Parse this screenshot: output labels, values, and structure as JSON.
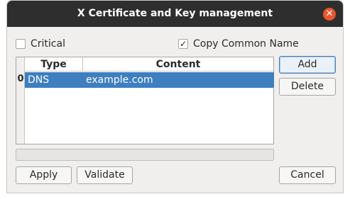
{
  "window": {
    "title": "X Certificate and Key management",
    "close_glyph": "✕"
  },
  "options": {
    "critical": {
      "label": "Critical",
      "checked": false,
      "mark": ""
    },
    "copy_common_name": {
      "label": "Copy Common Name",
      "checked": true,
      "mark": "✓"
    }
  },
  "table": {
    "headers": {
      "type": "Type",
      "content": "Content"
    },
    "rows": [
      {
        "index": "0",
        "type": "DNS",
        "content": "example.com",
        "selected": true
      }
    ]
  },
  "buttons": {
    "add": "Add",
    "delete": "Delete",
    "apply": "Apply",
    "validate": "Validate",
    "cancel": "Cancel"
  },
  "colors": {
    "titlebar": "#2e2e2e",
    "selection": "#3e7fbf",
    "close": "#e9572f"
  }
}
